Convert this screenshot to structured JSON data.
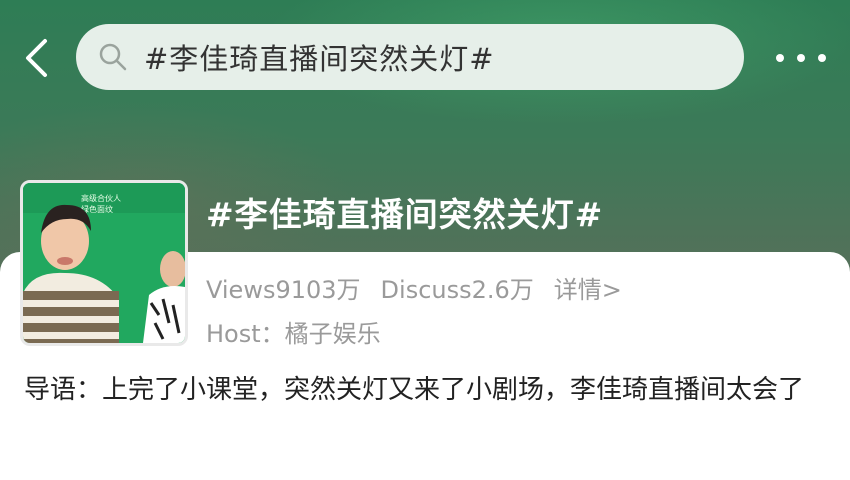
{
  "search": {
    "query": "#李佳琦直播间突然关灯#"
  },
  "topic": {
    "title": "#李佳琦直播间突然关灯#",
    "views": "Views9103万",
    "discuss": "Discuss2.6万",
    "details_link": "详情>",
    "host": "Host：橘子娱乐",
    "thumbnail_caption_line1": "高级合伙人",
    "thumbnail_caption_line2": "绿色面纹"
  },
  "intro": {
    "text": "导语：上完了小课堂，突然关灯又来了小剧场，李佳琦直播间太会了"
  },
  "icons": {
    "back": "chevron-left-icon",
    "search": "search-icon",
    "more": "more-dots-icon"
  },
  "colors": {
    "header_green": "#2e7d55",
    "card_bg": "#ffffff",
    "meta_text": "#9a9a9a"
  }
}
